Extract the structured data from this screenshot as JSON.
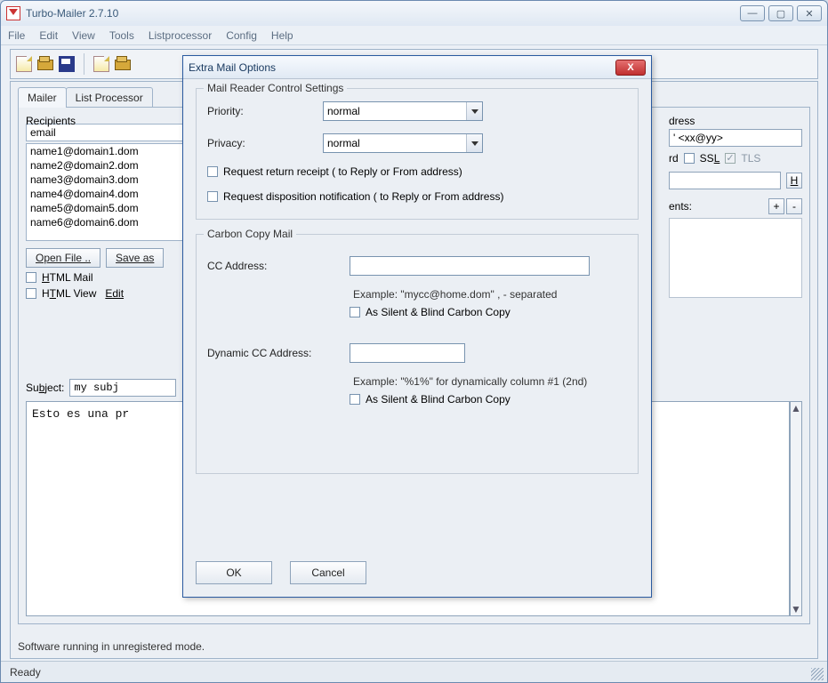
{
  "titlebar": {
    "title": "Turbo-Mailer 2.7.10"
  },
  "menu": {
    "file": "File",
    "edit": "Edit",
    "view": "View",
    "tools": "Tools",
    "listprocessor": "Listprocessor",
    "config": "Config",
    "help": "Help"
  },
  "tabs": {
    "mailer": "Mailer",
    "listprocessor": "List Processor"
  },
  "recipients": {
    "title": "Recipients",
    "bracket": "[",
    "header": "email",
    "items": [
      "name1@domain1.dom",
      "name2@domain2.dom",
      "name3@domain3.dom",
      "name4@domain4.dom",
      "name5@domain5.dom",
      "name6@domain6.dom"
    ],
    "open_btn": "Open File ..",
    "save_btn": "Save as"
  },
  "options": {
    "html_mail": "HTML Mail",
    "html_view": "HTML View",
    "edit": "Edit"
  },
  "subject": {
    "label": "Subject:",
    "value": "my subj"
  },
  "body_text": "Esto es una pr",
  "right": {
    "address_label": "dress",
    "address_value": "' <xx@yy>",
    "rd": "rd",
    "ssl": "SSL",
    "tls": "TLS",
    "h_btn": "H",
    "ents": "ents:",
    "plus": "+",
    "minus": "-"
  },
  "status_inner": "Software running in unregistered mode.",
  "status_outer": "Ready",
  "modal": {
    "title": "Extra Mail Options",
    "group1": {
      "title": "Mail Reader Control Settings",
      "priority_label": "Priority:",
      "priority_value": "normal",
      "privacy_label": "Privacy:",
      "privacy_value": "normal",
      "return_receipt": "Request return receipt  ( to Reply or From address)",
      "disposition": "Request disposition notification  ( to Reply or From address)"
    },
    "group2": {
      "title": "Carbon Copy Mail",
      "cc_label": "CC Address:",
      "cc_example": "Example: \"mycc@home.dom\"    , - separated",
      "cc_blind": "As Silent & Blind Carbon Copy",
      "dyn_label": "Dynamic CC Address:",
      "dyn_example": "Example: \"%1%\" for dynamically column #1 (2nd)",
      "dyn_blind": "As Silent & Blind Carbon Copy"
    },
    "ok": "OK",
    "cancel": "Cancel"
  }
}
